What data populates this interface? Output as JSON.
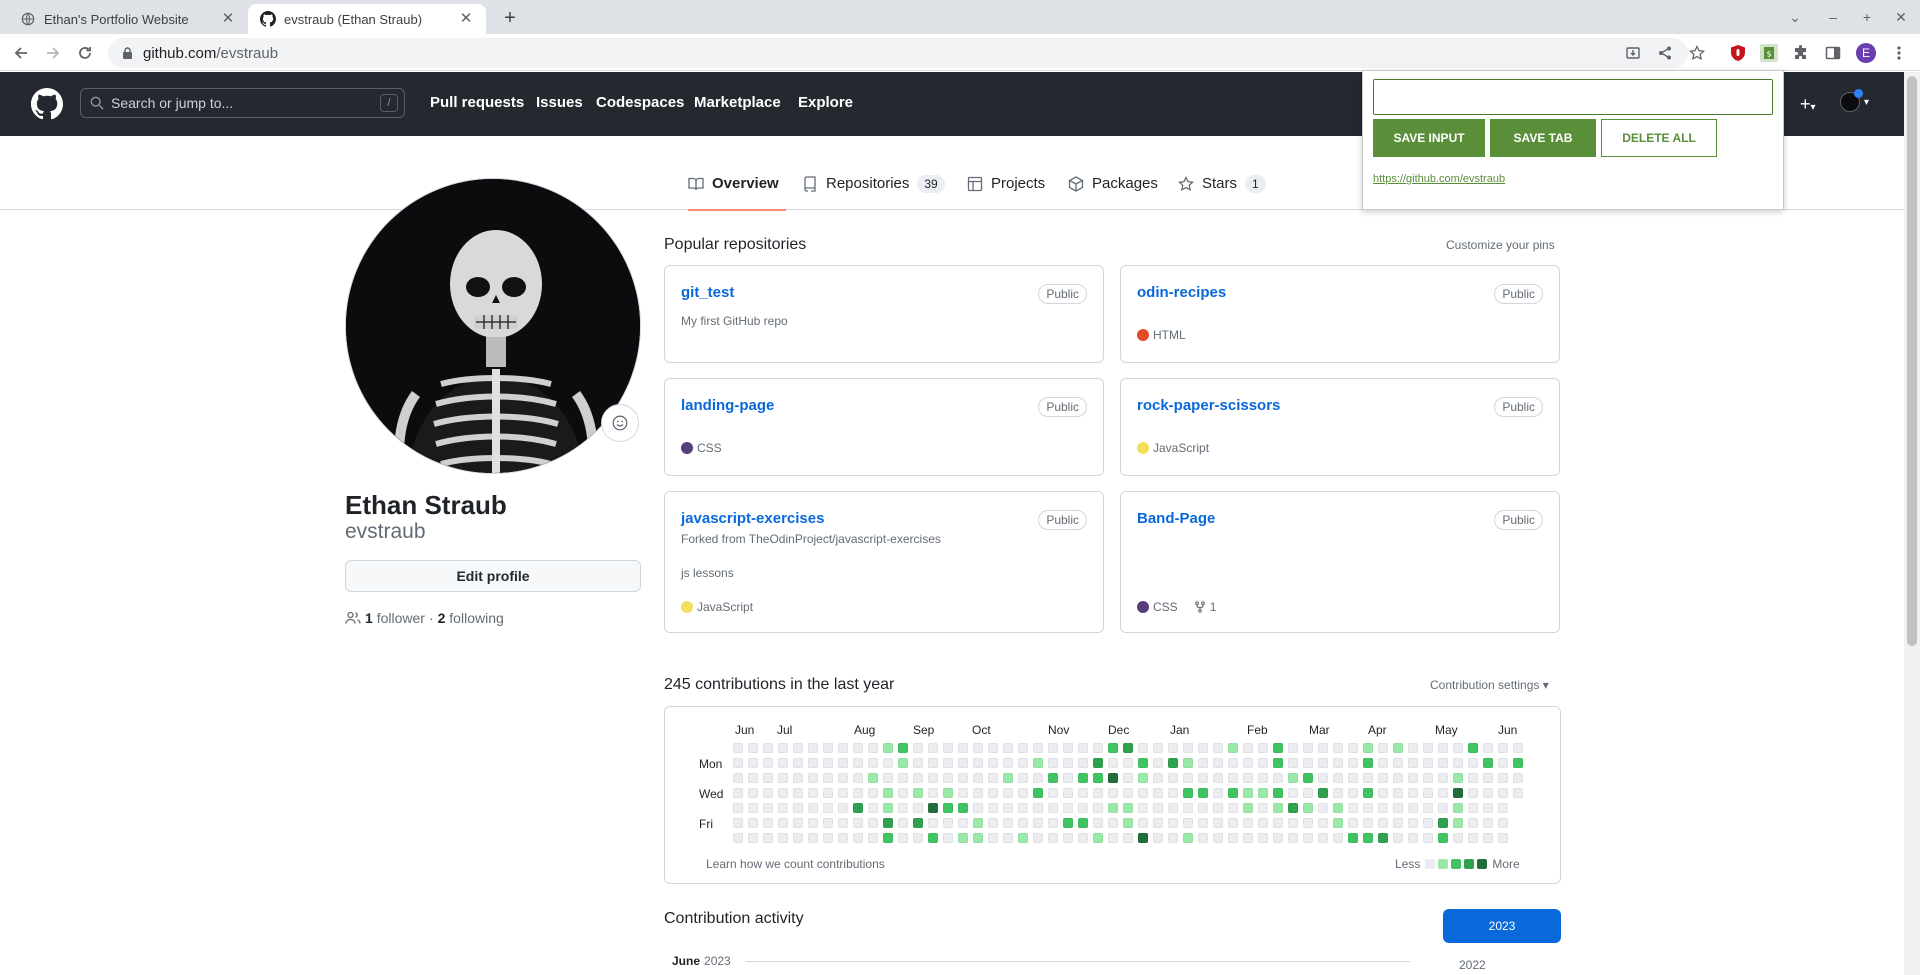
{
  "browser": {
    "tabs": [
      {
        "title": "Ethan's Portfolio Website",
        "icon": "globe-icon",
        "active": false
      },
      {
        "title": "evstraub (Ethan Straub)",
        "icon": "github-icon",
        "active": true
      }
    ],
    "url_host": "github.com",
    "url_path": "/evstraub",
    "profile_initial": "E"
  },
  "header": {
    "search_placeholder": "Search or jump to...",
    "search_shortcut": "/",
    "nav": [
      "Pull requests",
      "Issues",
      "Codespaces",
      "Marketplace",
      "Explore"
    ]
  },
  "profile_tabs": [
    {
      "label": "Overview",
      "icon": "book-icon",
      "count": null,
      "selected": true
    },
    {
      "label": "Repositories",
      "icon": "repo-icon",
      "count": "39",
      "selected": false
    },
    {
      "label": "Projects",
      "icon": "table-icon",
      "count": null,
      "selected": false
    },
    {
      "label": "Packages",
      "icon": "package-icon",
      "count": null,
      "selected": false
    },
    {
      "label": "Stars",
      "icon": "star-icon",
      "count": "1",
      "selected": false
    }
  ],
  "profile": {
    "name": "Ethan Straub",
    "login": "evstraub",
    "edit_label": "Edit profile",
    "followers": "1",
    "followers_label": "follower",
    "sep": "·",
    "following": "2",
    "following_label": "following"
  },
  "popular": {
    "title": "Popular repositories",
    "customize": "Customize your pins",
    "repos": [
      {
        "name": "git_test",
        "visibility": "Public",
        "description": "My first GitHub repo",
        "forked_from": "",
        "language": "",
        "lang_color": "",
        "forks": ""
      },
      {
        "name": "odin-recipes",
        "visibility": "Public",
        "description": "",
        "forked_from": "",
        "language": "HTML",
        "lang_color": "#e34c26",
        "forks": ""
      },
      {
        "name": "landing-page",
        "visibility": "Public",
        "description": "",
        "forked_from": "",
        "language": "CSS",
        "lang_color": "#563d7c",
        "forks": ""
      },
      {
        "name": "rock-paper-scissors",
        "visibility": "Public",
        "description": "",
        "forked_from": "",
        "language": "JavaScript",
        "lang_color": "#f1e05a",
        "forks": ""
      },
      {
        "name": "javascript-exercises",
        "visibility": "Public",
        "description": "js lessons",
        "forked_from": "Forked from TheOdinProject/javascript-exercises",
        "language": "JavaScript",
        "lang_color": "#f1e05a",
        "forks": ""
      },
      {
        "name": "Band-Page",
        "visibility": "Public",
        "description": "",
        "forked_from": "",
        "language": "CSS",
        "lang_color": "#563d7c",
        "forks": "1"
      }
    ]
  },
  "contributions": {
    "title": "245 contributions in the last year",
    "settings": "Contribution settings ▾",
    "months": [
      "Jun",
      "Jul",
      "Aug",
      "Sep",
      "Oct",
      "Nov",
      "Dec",
      "Jan",
      "Feb",
      "Mar",
      "Apr",
      "May",
      "Jun"
    ],
    "day_labels": [
      "Mon",
      "Wed",
      "Fri"
    ],
    "learn": "Learn how we count contributions",
    "less": "Less",
    "more": "More",
    "colors": [
      "#ebedf0",
      "#9be9a8",
      "#40c463",
      "#30a14e",
      "#216e39"
    ]
  },
  "activity": {
    "title": "Contribution activity",
    "month": "June",
    "year": "2023",
    "years": [
      "2023",
      "2022"
    ]
  },
  "extension_popup": {
    "input_value": "",
    "save_input": "SAVE INPUT",
    "save_tab": "SAVE TAB",
    "delete_all": "DELETE ALL",
    "saved_link": "https://github.com/evstraub",
    "accent": "#5a8f3a"
  }
}
